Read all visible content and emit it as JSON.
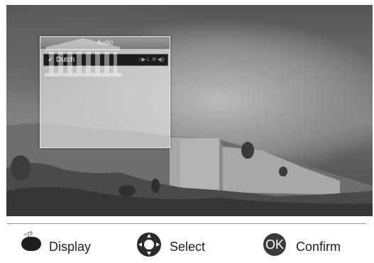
{
  "audio_menu": {
    "title": "Audio",
    "selected_language": "Dutch",
    "check_mark": "✓",
    "left_label": "L",
    "right_label": "R"
  },
  "footer": {
    "display_label": "Display",
    "select_label": "Select",
    "ok_key": "OK",
    "confirm_label": "Confirm"
  },
  "icons": {
    "display": "mute-question-icon",
    "select": "navigation-pad-icon",
    "confirm": "ok-button-icon",
    "speaker": "speaker-icon"
  }
}
